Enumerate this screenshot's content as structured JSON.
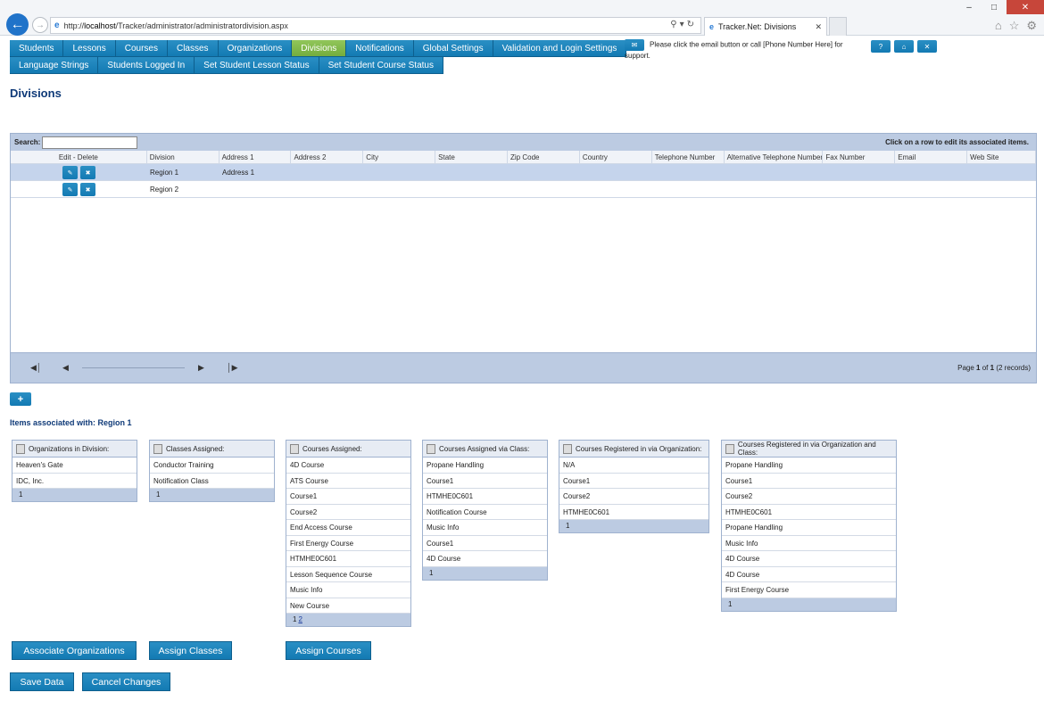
{
  "browser": {
    "url_prefix": "http://",
    "url_host": "localhost",
    "url_path": "/Tracker/administrator/administratordivision.aspx",
    "tab_title": "Tracker.Net: Divisions"
  },
  "menu": {
    "row1": [
      "Students",
      "Lessons",
      "Courses",
      "Classes",
      "Organizations",
      "Divisions",
      "Notifications",
      "Global Settings",
      "Validation and Login Settings"
    ],
    "row2": [
      "Language Strings",
      "Students Logged In",
      "Set Student Lesson Status",
      "Set Student Course Status"
    ],
    "active": "Divisions"
  },
  "support": {
    "text": "Please click the email button or call [Phone Number Here] for support."
  },
  "page": {
    "title": "Divisions"
  },
  "grid": {
    "search_label": "Search:",
    "hint": "Click on a row to edit its associated items.",
    "columns": [
      "Edit - Delete",
      "Division",
      "Address 1",
      "Address 2",
      "City",
      "State",
      "Zip Code",
      "Country",
      "Telephone Number",
      "Alternative Telephone Number",
      "Fax Number",
      "Email",
      "Web Site"
    ],
    "rows": [
      {
        "division": "Region 1",
        "address1": "Address 1",
        "selected": true
      },
      {
        "division": "Region 2",
        "address1": "",
        "selected": false
      }
    ],
    "pager_page_label": "Page",
    "pager_page": "1",
    "pager_of": "of",
    "pager_total": "1",
    "pager_records": "(2 records)"
  },
  "associated": {
    "label": "Items associated with: Region 1"
  },
  "boxes": {
    "organizations": {
      "title": "Organizations in Division:",
      "items": [
        "Heaven's Gate",
        "IDC, Inc."
      ],
      "pages": "1"
    },
    "classes": {
      "title": "Classes Assigned:",
      "items": [
        "Conductor Training",
        "Notification Class"
      ],
      "pages": "1"
    },
    "courses": {
      "title": "Courses Assigned:",
      "items": [
        "4D Course",
        "ATS Course",
        "Course1",
        "Course2",
        "End Access Course",
        "First Energy Course",
        "HTMHE0C601",
        "Lesson Sequence Course",
        "Music Info",
        "New Course"
      ],
      "page1": "1",
      "page2": "2"
    },
    "courses_via_class": {
      "title": "Courses Assigned via Class:",
      "items": [
        "Propane Handling",
        "Course1",
        "HTMHE0C601",
        "Notification Course",
        "Music Info",
        "Course1",
        "4D Course"
      ],
      "pages": "1"
    },
    "courses_via_org": {
      "title": "Courses Registered in via Organization:",
      "items": [
        "N/A",
        "Course1",
        "Course2",
        "HTMHE0C601"
      ],
      "pages": "1"
    },
    "courses_via_org_class": {
      "title": "Courses Registered in via Organization and Class:",
      "items": [
        "Propane Handling",
        "Course1",
        "Course2",
        "HTMHE0C601",
        "Propane Handling",
        "Music Info",
        "4D Course",
        "4D Course",
        "First Energy Course"
      ],
      "pages": "1"
    }
  },
  "buttons": {
    "associate_orgs": "Associate Organizations",
    "assign_classes": "Assign Classes",
    "assign_courses": "Assign Courses",
    "save": "Save Data",
    "cancel": "Cancel Changes"
  }
}
